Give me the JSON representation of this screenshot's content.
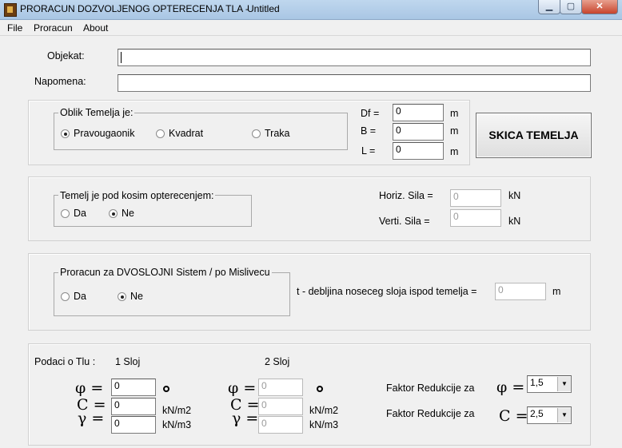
{
  "window": {
    "title": "PRORACUN DOZVOLJENOG OPTERECENJA TLA -",
    "document": "Untitled",
    "minimize": "▁",
    "maximize": "▢",
    "close": "✕"
  },
  "menu": [
    "File",
    "Proracun",
    "About"
  ],
  "project": {
    "object_label": "Objekat:",
    "object_value": "",
    "note_label": "Napomena:",
    "note_value": ""
  },
  "foundation": {
    "group_title": "Oblik Temelja je:",
    "shapes": [
      {
        "label": "Pravougaonik",
        "selected": true
      },
      {
        "label": "Kvadrat",
        "selected": false
      },
      {
        "label": "Traka",
        "selected": false
      }
    ],
    "dims": [
      {
        "label": "Df =",
        "value": "0",
        "unit": "m"
      },
      {
        "label": "B =",
        "value": "0",
        "unit": "m"
      },
      {
        "label": "L =",
        "value": "0",
        "unit": "m"
      }
    ],
    "sketch_button": "SKICA TEMELJA"
  },
  "inclined": {
    "group_title": "Temelj je pod kosim opterecenjem:",
    "options": [
      {
        "label": "Da",
        "selected": false
      },
      {
        "label": "Ne",
        "selected": true
      }
    ],
    "horiz_label": "Horiz. Sila =",
    "horiz_value": "0",
    "horiz_unit": "kN",
    "vert_label": "Verti.  Sila =",
    "vert_value": "0",
    "vert_unit": "kN"
  },
  "two_layer": {
    "group_title": "Proracun za DVOSLOJNI Sistem / po Mislivecu",
    "options": [
      {
        "label": "Da",
        "selected": false
      },
      {
        "label": "Ne",
        "selected": true
      }
    ],
    "thickness_label": "t - debljina noseceg sloja ispod temelja =",
    "thickness_value": "0",
    "thickness_unit": "m"
  },
  "soil": {
    "section_label": "Podaci o Tlu :",
    "layer1_label": "1 Sloj",
    "layer2_label": "2 Sloj",
    "symbols": [
      "φ =",
      "C =",
      "γ ="
    ],
    "layer1": [
      "0",
      "0",
      "0"
    ],
    "layer2": [
      "0",
      "0",
      "0"
    ],
    "units": [
      "",
      "kN/m2",
      "kN/m3"
    ],
    "reduction_label_1": "Faktor Redukcije za",
    "reduction_sym_1": "φ =",
    "reduction_value_1": "1,5",
    "reduction_label_2": "Faktor Redukcije za",
    "reduction_sym_2": "C =",
    "reduction_value_2": "2,5"
  }
}
